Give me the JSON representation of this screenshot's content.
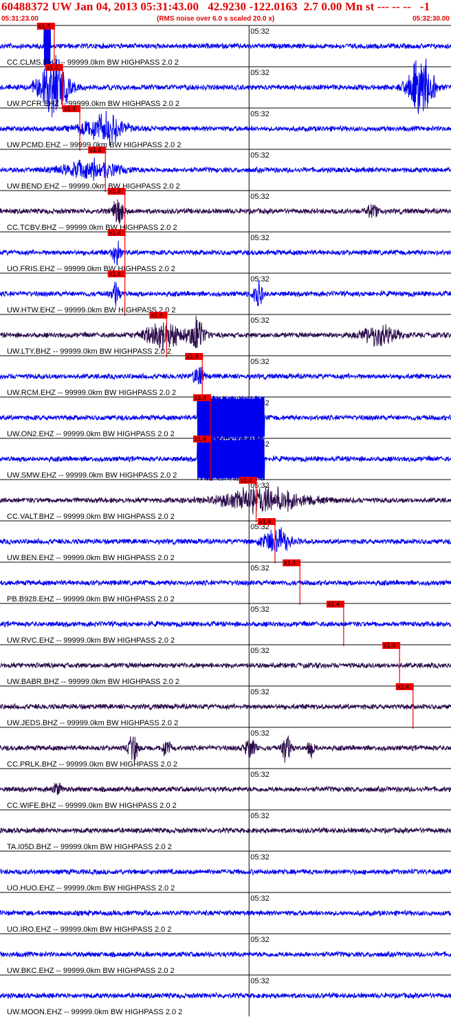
{
  "header": {
    "title": "60488372 UW Jan 04, 2013 05:31:43.00   42.9230 -122.0163  2.7 0.00 Mn st --- -- --   -1",
    "start_time": "05:31:23.00",
    "rms_note": "(RMS noise over 6.0 s scaled 20.0 x)",
    "end_time": "05:32:30.00"
  },
  "colors": {
    "text": "#e00000",
    "blue": "#0000ee",
    "purple": "#2a0a4a",
    "pick": "#ee0000"
  },
  "chart_data": {
    "type": "line",
    "title": "60488372 UW Jan 04, 2013 05:31:43.00   42.9230 -122.0163  2.7 0.00 Mn st --- -- --   -1",
    "x_range": [
      "05:31:23.00",
      "05:32:30.00"
    ],
    "minute_tick_label": "05:32",
    "pick_label": "x1.4",
    "grid": false,
    "series": [
      {
        "name": "CC.CLMS.EHZ -- 99999.0km BW  HIGHPASS  2.0  2",
        "color": "blue",
        "pick_s": 5.5,
        "bursts": [
          [
            7.0,
            1,
            2.6,
            "sat"
          ]
        ]
      },
      {
        "name": "UW.PCFR.EHZ -- 99999.0km BW  HIGHPASS  2.0  2",
        "color": "blue",
        "pick_s": 6.7,
        "bursts": [
          [
            8.0,
            2.2,
            2.0,
            "big"
          ],
          [
            62.5,
            1.8,
            2.0,
            "big"
          ]
        ]
      },
      {
        "name": "UW.PCMD.EHZ -- 99999.0km BW  HIGHPASS  2.0  2",
        "color": "blue",
        "pick_s": 9.3,
        "bursts": [
          [
            15.5,
            3,
            1.0,
            "mid"
          ]
        ]
      },
      {
        "name": "UW.BEND.EHZ -- 99999.0km BW  HIGHPASS  2.0  2",
        "color": "blue",
        "pick_s": 13.1,
        "bursts": [
          [
            13.5,
            4,
            0.6,
            "mid"
          ]
        ]
      },
      {
        "name": "CC.TCBV.BHZ -- 99999.0km BW  HIGHPASS  2.0  2",
        "color": "purple",
        "pick_s": 16.0,
        "bursts": [
          [
            17.6,
            0.8,
            0.9,
            "mid"
          ],
          [
            55.3,
            0.8,
            0.4,
            "mid"
          ]
        ]
      },
      {
        "name": "UO.FRIS.EHZ -- 99999.0km BW  HIGHPASS  2.0  2",
        "color": "blue",
        "pick_s": 16.0,
        "bursts": [
          [
            17.3,
            0.6,
            1.0,
            "mid"
          ]
        ]
      },
      {
        "name": "UW.HTW.EHZ -- 99999.0km BW  HIGHPASS  2.0  2",
        "color": "blue",
        "pick_s": 16.0,
        "bursts": [
          [
            17.2,
            0.5,
            1.0,
            "mid"
          ],
          [
            38.3,
            0.6,
            1.2,
            "mid"
          ]
        ]
      },
      {
        "name": "UW.LTY.BHZ -- 99999.0km BW  HIGHPASS  2.0  2",
        "color": "purple",
        "pick_s": 22.2,
        "bursts": [
          [
            24.2,
            2.5,
            1.0,
            "mid"
          ],
          [
            29.2,
            1.2,
            1.2,
            "mid"
          ],
          [
            56.5,
            2.5,
            0.7,
            "mid"
          ]
        ]
      },
      {
        "name": "UW.RCM.EHZ -- 99999.0km BW  HIGHPASS  2.0  2",
        "color": "blue",
        "pick_s": 27.5,
        "bursts": [
          [
            29.5,
            0.8,
            0.7,
            "mid"
          ]
        ]
      },
      {
        "name": "UW.ON2.EHZ -- 99999.0km BW  HIGHPASS  2.0  2",
        "color": "blue",
        "pick_s": 28.7,
        "bursts": [
          [
            34.3,
            10,
            2.6,
            "sat"
          ]
        ]
      },
      {
        "name": "UW.SMW.EHZ -- 99999.0km BW  HIGHPASS  2.0  2",
        "color": "blue",
        "pick_s": 28.7,
        "bursts": [
          [
            34.3,
            10,
            2.6,
            "sat"
          ]
        ]
      },
      {
        "name": "CC.VALT.BHZ -- 99999.0km BW  HIGHPASS  2.0  2",
        "color": "purple",
        "pick_s": 35.5,
        "bursts": [
          [
            39.0,
            6,
            0.8,
            "mid"
          ]
        ]
      },
      {
        "name": "UW.BEN.EHZ -- 99999.0km BW  HIGHPASS  2.0  2",
        "color": "blue",
        "pick_s": 38.3,
        "bursts": [
          [
            41.0,
            2,
            0.9,
            "mid"
          ]
        ]
      },
      {
        "name": "PB.B928.EHZ -- 99999.0km BW  HIGHPASS  2.0  2",
        "color": "blue",
        "pick_s": 42.0,
        "bursts": []
      },
      {
        "name": "UW.RVC.EHZ -- 99999.0km BW  HIGHPASS  2.0  2",
        "color": "blue",
        "pick_s": 48.5,
        "bursts": []
      },
      {
        "name": "UW.BABR.BHZ -- 99999.0km BW  HIGHPASS  2.0  2",
        "color": "purple",
        "pick_s": 56.8,
        "bursts": []
      },
      {
        "name": "UW.JEDS.BHZ -- 99999.0km BW  HIGHPASS  2.0  2",
        "color": "purple",
        "pick_s": 58.8,
        "bursts": []
      },
      {
        "name": "CC.PRLK.BHZ -- 99999.0km BW  HIGHPASS  2.0  2",
        "color": "purple",
        "pick_s": null,
        "bursts": [
          [
            19.8,
            0.7,
            0.9,
            "mid"
          ],
          [
            24.7,
            0.6,
            0.7,
            "mid"
          ],
          [
            37.2,
            0.8,
            0.7,
            "mid"
          ],
          [
            42.6,
            0.6,
            1.1,
            "mid"
          ],
          [
            46.2,
            0.5,
            0.6,
            "mid"
          ]
        ]
      },
      {
        "name": "CC.WIFE.BHZ -- 99999.0km BW  HIGHPASS  2.0  2",
        "color": "purple",
        "pick_s": null,
        "bursts": [
          [
            8.5,
            0.5,
            0.5,
            "mid"
          ]
        ]
      },
      {
        "name": "TA.I05D.BHZ -- 99999.0km BW  HIGHPASS  2.0  2",
        "color": "purple",
        "pick_s": null,
        "bursts": []
      },
      {
        "name": "UO.HUO.EHZ -- 99999.0km BW  HIGHPASS  2.0  2",
        "color": "blue",
        "pick_s": null,
        "bursts": []
      },
      {
        "name": "UO.IRO.EHZ -- 99999.0km BW  HIGHPASS  2.0  2",
        "color": "blue",
        "pick_s": null,
        "bursts": []
      },
      {
        "name": "UW.BKC.EHZ -- 99999.0km BW  HIGHPASS  2.0  2",
        "color": "blue",
        "pick_s": null,
        "bursts": []
      },
      {
        "name": "UW.MOON.EHZ -- 99999.0km BW  HIGHPASS  2.0  2",
        "color": "blue",
        "pick_s": null,
        "bursts": []
      }
    ]
  }
}
